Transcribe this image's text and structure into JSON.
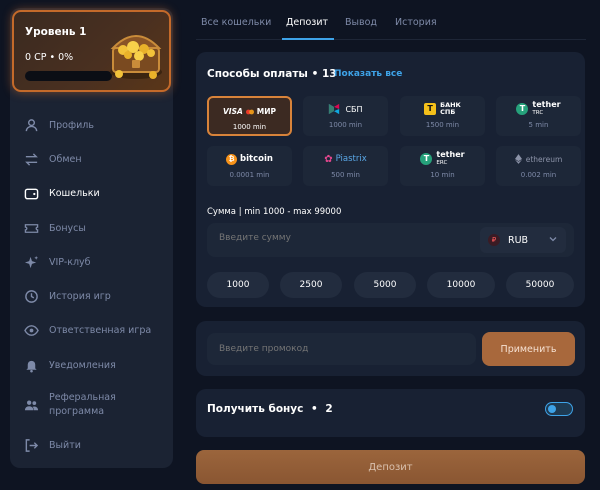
{
  "sidebar": {
    "level": {
      "title": "Уровень 1",
      "stats": "0 СР • 0%",
      "progress": 0
    },
    "items": [
      {
        "label": "Профиль",
        "icon": "user-icon"
      },
      {
        "label": "Обмен",
        "icon": "exchange-icon"
      },
      {
        "label": "Кошельки",
        "icon": "wallet-icon",
        "active": true
      },
      {
        "label": "Бонусы",
        "icon": "ticket-icon"
      },
      {
        "label": "VIP-клуб",
        "icon": "sparkle-icon"
      },
      {
        "label": "История игр",
        "icon": "history-icon"
      },
      {
        "label": "Ответственная игра",
        "icon": "eye-icon"
      },
      {
        "label": "Уведомления",
        "icon": "bell-icon"
      },
      {
        "label": "Реферальная программа",
        "icon": "people-icon"
      },
      {
        "label": "Выйти",
        "icon": "logout-icon"
      }
    ]
  },
  "tabs": [
    {
      "label": "Все кошельки"
    },
    {
      "label": "Депозит",
      "active": true
    },
    {
      "label": "Вывод"
    },
    {
      "label": "История"
    }
  ],
  "payment": {
    "title": "Способы оплаты",
    "count": "• 13",
    "show_all": "Показать все",
    "methods": [
      {
        "logo": "VISA ● МИР",
        "min": "1000 min",
        "selected": true
      },
      {
        "logo": "СБП",
        "min": "1000 min"
      },
      {
        "logo": "БАНК СПБ",
        "min": "1500 min"
      },
      {
        "logo": "tether TRC",
        "min": "5 min"
      },
      {
        "logo": "bitcoin",
        "min": "0.0001 min"
      },
      {
        "logo": "Piastrix",
        "min": "500 min"
      },
      {
        "logo": "tether ERC",
        "min": "10 min"
      },
      {
        "logo": "ethereum",
        "min": "0.002 min"
      }
    ],
    "sum_label": "Сумма | min 1000 - max 99000",
    "amount_placeholder": "Введите сумму",
    "currency": "RUB",
    "currency_symbol": "₽",
    "chips": [
      "1000",
      "2500",
      "5000",
      "10000",
      "50000"
    ]
  },
  "promo": {
    "placeholder": "Введите промокод",
    "apply": "Применить"
  },
  "bonus": {
    "label": "Получить бонус",
    "count": "2"
  },
  "deposit_button": "Депозит",
  "colors": {
    "accent": "#3ea3e8",
    "orange": "#d8833a",
    "bg": "#0e1422",
    "panel": "#182133"
  }
}
